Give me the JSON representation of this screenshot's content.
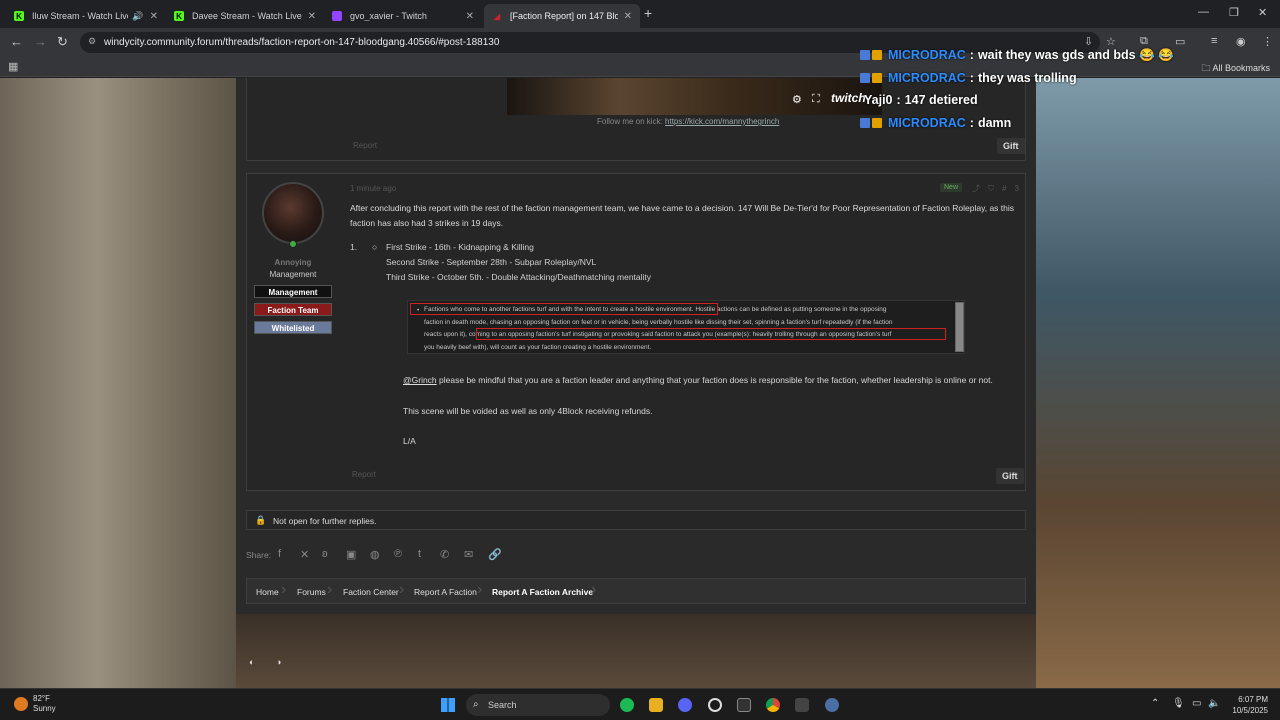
{
  "tabs": [
    {
      "title": "Iluw Stream - Watch Live on",
      "favicon": "kick-icon",
      "color": "#53fc18"
    },
    {
      "title": "Davee Stream - Watch Live on I",
      "favicon": "kick-icon",
      "color": "#53fc18"
    },
    {
      "title": "gvo_xavier - Twitch",
      "favicon": "twitch-icon",
      "color": "#9146ff"
    },
    {
      "title": "[Faction Report] on 147 BloodG",
      "favicon": "forum-icon",
      "color": "#c23"
    }
  ],
  "address": {
    "url": "windycity.community.forum/threads/faction-report-on-147-bloodgang.40566/#post-188130"
  },
  "bookmarks": {
    "all_label": "All Bookmarks"
  },
  "previous_post": {
    "follow_text": "Follow me on kick:",
    "follow_link": "https://kick.com/mannythegrinch",
    "report_label": "Report",
    "gift_label": "Gift"
  },
  "post": {
    "time": "1 minute ago",
    "new_label": "New",
    "number": "#3",
    "author": {
      "name": "Annoying",
      "role": "Management"
    },
    "badges": [
      {
        "label": "Management",
        "bg": "#111111"
      },
      {
        "label": "Faction Team",
        "bg": "#8b1a1a"
      },
      {
        "label": "Whitelisted",
        "bg": "#6a7a9a"
      }
    ],
    "intro": "After concluding this report with the rest of the faction management team, we have came to a decision. 147 Will Be De-Tier'd for Poor Representation of Faction Roleplay, as this faction has also had 3 strikes in 19 days.",
    "list_number": "1.",
    "strikes": [
      "First Strike - 16th - Kidnapping & Killing",
      "Second Strike - September 28th - Subpar Roleplay/NVL",
      "Third Strike - October 5th. - Double Attacking/Deathmatching mentality"
    ],
    "rule_excerpt": {
      "line1": "Factions who come to another factions turf and with the intent to create a hostile environment. Hostile actions can be defined as putting someone in the opposing",
      "line2": "faction in death mode, chasing an opposing faction on feet or in vehicle, being verbally hostile like dissing their set, spinning a faction's turf repeatedly (if the faction",
      "line3": "reacts upon it), coming to an opposing faction's turf instigating or provoking said faction to attack you (example(s): heavily trolling through an opposing faction's turf",
      "line4": "you heavily beef with), will count as your faction creating a hostile environment."
    },
    "mention": "@Grinch",
    "mention_text": " please be mindful that you are a faction leader and anything that your faction does is responsible for the faction, whether leadership is online or not.",
    "void_text": "This scene will be voided as well as only 4Block receiving refunds.",
    "signoff": "L/A",
    "report_label": "Report",
    "gift_label": "Gift"
  },
  "closed_notice": "Not open for further replies.",
  "share": {
    "label": "Share:",
    "icons": [
      "facebook-icon",
      "x-icon",
      "bluesky-icon",
      "linkedin-icon",
      "reddit-icon",
      "pinterest-icon",
      "tumblr-icon",
      "whatsapp-icon",
      "email-icon",
      "link-icon"
    ]
  },
  "breadcrumbs": [
    "Home",
    "Forums",
    "Faction Center",
    "Report A Faction",
    "Report A Faction Archive"
  ],
  "chat": [
    {
      "user": "MICRODRAC",
      "message": "wait they was gds and bds 😂 😂",
      "color": "#2b8cff",
      "badges": true
    },
    {
      "user": "MICRODRAC",
      "message": "they was trolling",
      "color": "#2b8cff",
      "badges": true
    },
    {
      "user": "Yaji0",
      "message": "147 detiered",
      "color": "#ffffff",
      "badges": false
    },
    {
      "user": "MICRODRAC",
      "message": "damn",
      "color": "#2b8cff",
      "badges": true
    }
  ],
  "stream_overlay": {
    "brand": "twitch"
  },
  "taskbar": {
    "weather_temp": "82°F",
    "weather_desc": "Sunny",
    "search_label": "Search",
    "time": "6:07 PM",
    "date": "10/5/2025"
  }
}
